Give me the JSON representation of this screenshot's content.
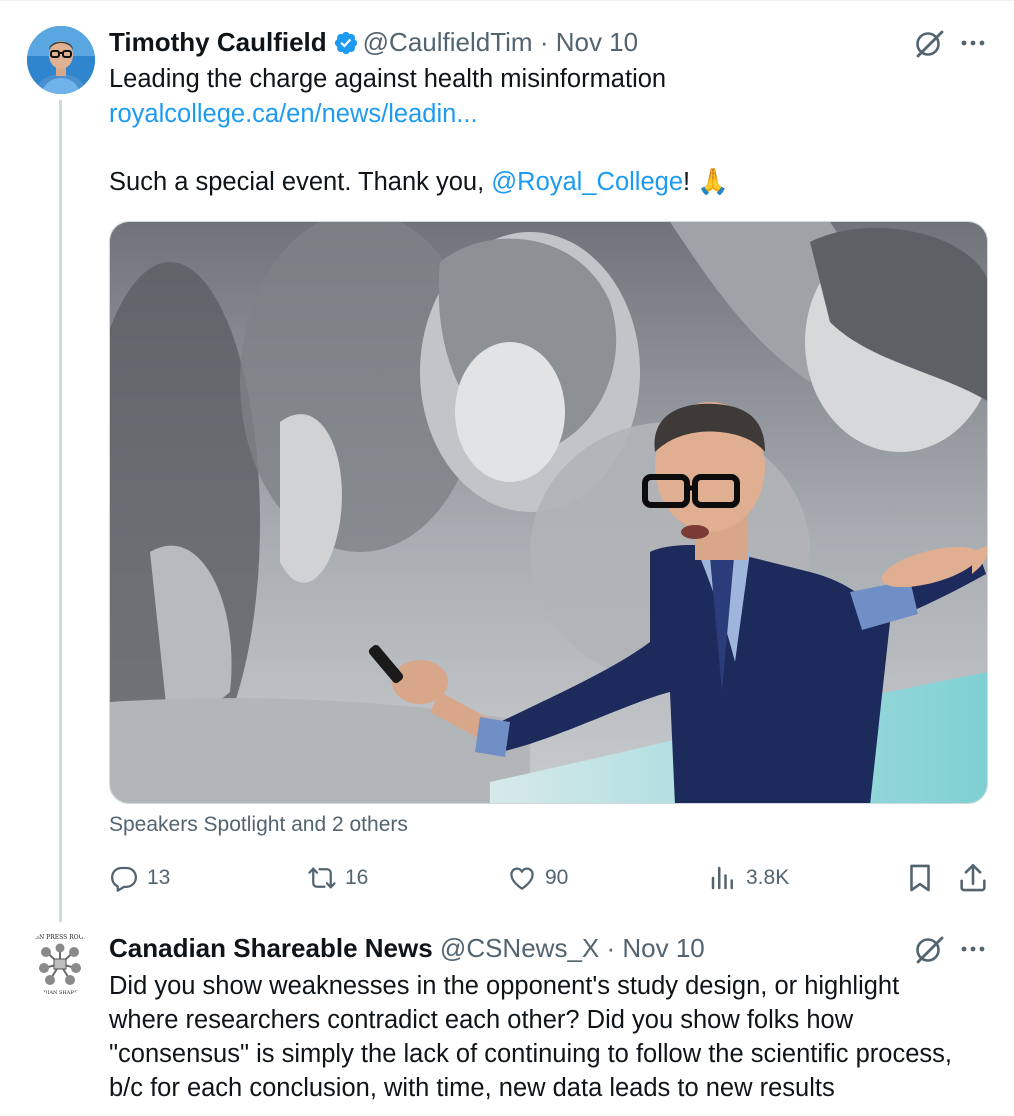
{
  "tweet1": {
    "author_name": "Timothy Caulfield",
    "handle": "@CaulfieldTim",
    "separator": "·",
    "date": "Nov 10",
    "line1": "Leading the charge against health misinformation",
    "link": "royalcollege.ca/en/news/leadin...",
    "line3_prefix": "Such a special event. Thank you, ",
    "mention": "@Royal_College",
    "line3_suffix": "! 🙏",
    "tagged": "Speakers Spotlight and 2 others",
    "stats": {
      "replies": "13",
      "reposts": "16",
      "likes": "90",
      "views": "3.8K"
    }
  },
  "tweet2": {
    "author_name": "Canadian Shareable News",
    "handle": "@CSNews_X",
    "separator": "·",
    "date": "Nov 10",
    "avatar_top_text": "CSN PRESS ROOM",
    "avatar_bottom_text": "CANADIAN SHAREABLE",
    "lines": [
      "Did you show weaknesses in the opponent's study design, or highlight",
      "where researchers contradict each other? Did you show folks how",
      "\"consensus\" is simply the lack of continuing to follow the scientific process,",
      "b/c for each conclusion, with time, new data leads to new results"
    ]
  },
  "colors": {
    "link": "#1d9bf0",
    "secondary_text": "#536471",
    "thread_line": "#cfd9de",
    "verified_badge": "#1d9bf0"
  },
  "icons": {
    "verified": "verified-badge-icon",
    "grok": "grok-icon",
    "more": "more-dots-icon",
    "reply": "reply-bubble-icon",
    "repost": "repost-arrows-icon",
    "like": "heart-icon",
    "views": "views-bar-chart-icon",
    "bookmark": "bookmark-icon",
    "share": "share-upload-icon"
  }
}
